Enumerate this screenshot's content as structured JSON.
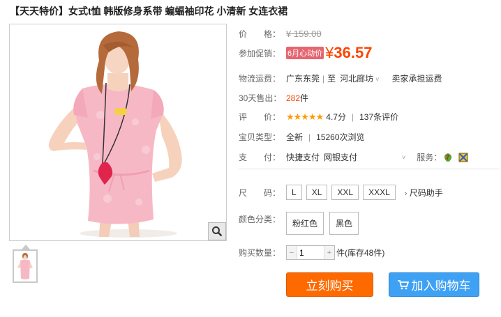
{
  "product": {
    "title": "【天天特价】女式t恤 韩版修身系带 蝙蝠袖印花 小清新 女连衣裙"
  },
  "price": {
    "label": "价　　格：",
    "original": "¥ 159.00"
  },
  "promo": {
    "label": "参加促销：",
    "tag": "6月心动价",
    "currency": "¥",
    "value": "36.57"
  },
  "shipping": {
    "label": "物流运费：",
    "from": "广东东莞",
    "to_prefix": "至",
    "to": "河北廊坊",
    "fee": "卖家承担运费"
  },
  "sales": {
    "label": "30天售出：",
    "count": "282",
    "unit": "件"
  },
  "rating": {
    "label": "评　　价：",
    "stars": "★★★★★",
    "score": "4.7分",
    "reviews": "137条评价"
  },
  "item_type": {
    "label": "宝贝类型：",
    "condition": "全新",
    "views": "15260次浏览"
  },
  "payment": {
    "label": "支　　付：",
    "methods": [
      "快捷支付",
      "网银支付"
    ],
    "service_label": "服务："
  },
  "size": {
    "label": "尺　　码：",
    "options": [
      "L",
      "XL",
      "XXL",
      "XXXL"
    ],
    "helper": "尺码助手"
  },
  "color": {
    "label": "颜色分类：",
    "options": [
      "粉红色",
      "黑色"
    ]
  },
  "quantity": {
    "label": "购买数量：",
    "value": "1",
    "unit": "件",
    "stock": "(库存48件)"
  },
  "actions": {
    "buy_now": "立刻购买",
    "add_cart": "加入购物车"
  },
  "colors": {
    "accent": "#ff4400",
    "buy_button": "#ff6a00",
    "cart_button": "#3ea1f4",
    "promo_tag": "#e56570",
    "stars": "#ff9a00"
  }
}
